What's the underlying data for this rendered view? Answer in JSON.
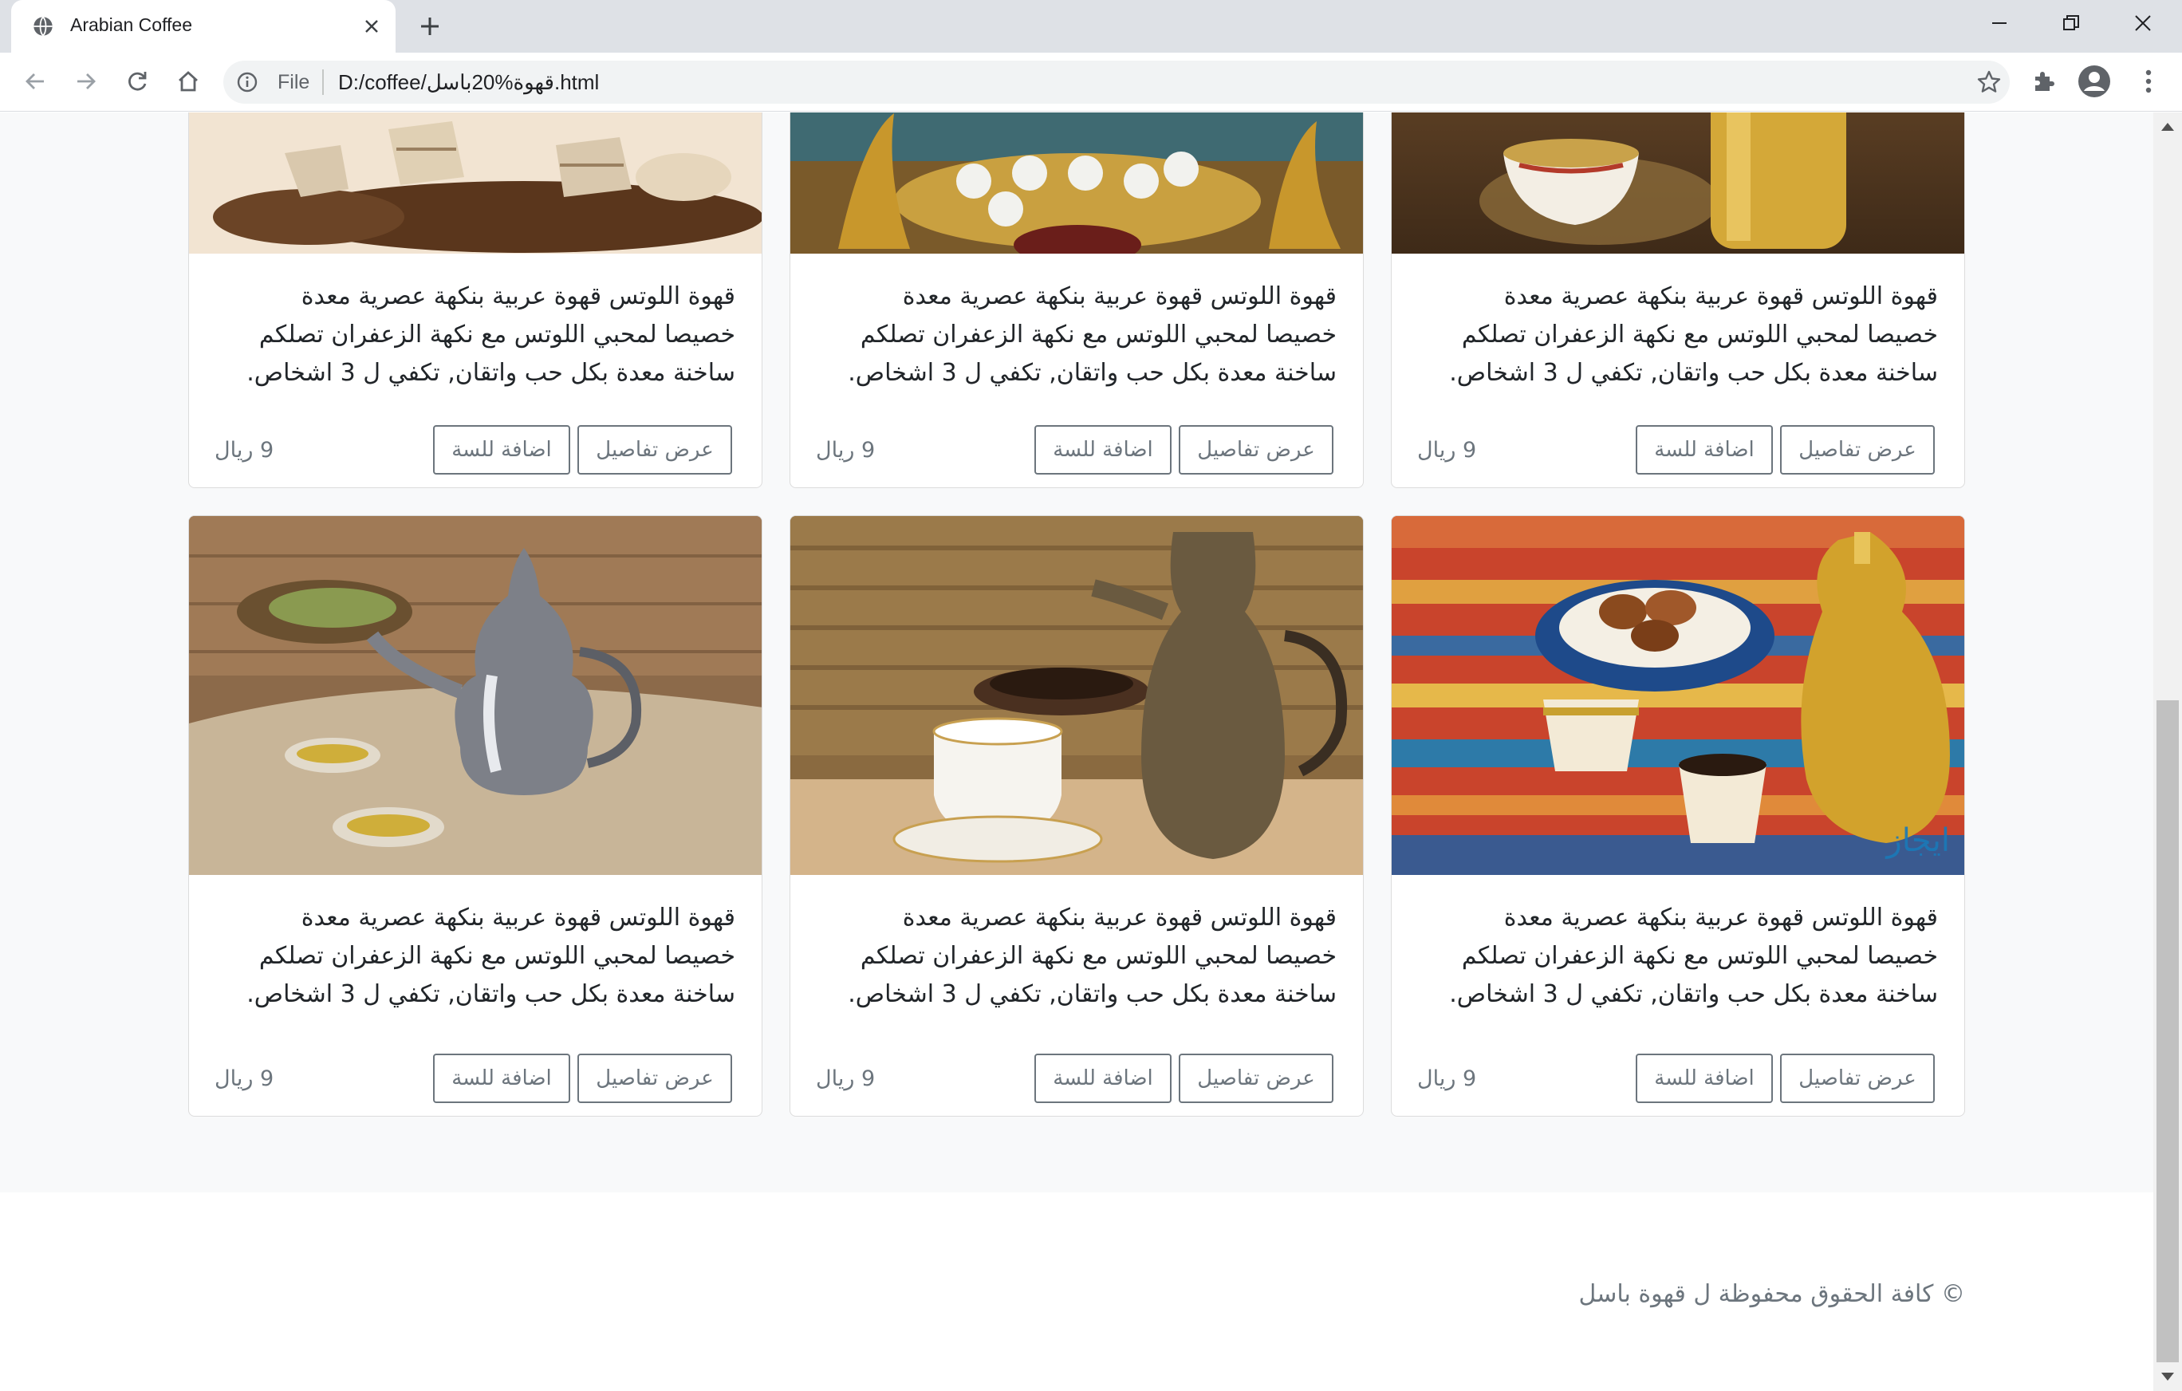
{
  "browser": {
    "tab_title": "Arabian Coffee",
    "url_scheme": "File",
    "url": "D:/coffee/قهوة%20باسل.html"
  },
  "products": [
    {
      "description": "قهوة اللوتس قهوة عربية بنكهة عصرية معدة خصيصا لمحبي اللوتس مع نكهة الزعفران تصلكم ساخنة معدة بكل حب واتقان, تكفي ل 3 اشخاص.",
      "details_label": "عرض تفاصيل",
      "add_label": "اضافة للسة",
      "price": "9 ريال"
    },
    {
      "description": "قهوة اللوتس قهوة عربية بنكهة عصرية معدة خصيصا لمحبي اللوتس مع نكهة الزعفران تصلكم ساخنة معدة بكل حب واتقان, تكفي ل 3 اشخاص.",
      "details_label": "عرض تفاصيل",
      "add_label": "اضافة للسة",
      "price": "9 ريال"
    },
    {
      "description": "قهوة اللوتس قهوة عربية بنكهة عصرية معدة خصيصا لمحبي اللوتس مع نكهة الزعفران تصلكم ساخنة معدة بكل حب واتقان, تكفي ل 3 اشخاص.",
      "details_label": "عرض تفاصيل",
      "add_label": "اضافة للسة",
      "price": "9 ريال"
    },
    {
      "description": "قهوة اللوتس قهوة عربية بنكهة عصرية معدة خصيصا لمحبي اللوتس مع نكهة الزعفران تصلكم ساخنة معدة بكل حب واتقان, تكفي ل 3 اشخاص.",
      "details_label": "عرض تفاصيل",
      "add_label": "اضافة للسة",
      "price": "9 ريال"
    },
    {
      "description": "قهوة اللوتس قهوة عربية بنكهة عصرية معدة خصيصا لمحبي اللوتس مع نكهة الزعفران تصلكم ساخنة معدة بكل حب واتقان, تكفي ل 3 اشخاص.",
      "details_label": "عرض تفاصيل",
      "add_label": "اضافة للسة",
      "price": "9 ريال"
    },
    {
      "description": "قهوة اللوتس قهوة عربية بنكهة عصرية معدة خصيصا لمحبي اللوتس مع نكهة الزعفران تصلكم ساخنة معدة بكل حب واتقان, تكفي ل 3 اشخاص.",
      "details_label": "عرض تفاصيل",
      "add_label": "اضافة للسة",
      "price": "9 ريال",
      "image_watermark": "ايجاز"
    }
  ],
  "footer": {
    "copyright": "© كافة الحقوق محفوظة ل قهوة باسل"
  },
  "colors": {
    "tabstrip": "#dee1e6",
    "page_bg": "#f8f9fa",
    "button_outline": "#6c757d"
  },
  "icons": [
    "globe-icon",
    "close-icon",
    "plus-icon",
    "minimize-icon",
    "restore-icon",
    "back-icon",
    "forward-icon",
    "reload-icon",
    "home-icon",
    "info-icon",
    "star-icon",
    "extensions-icon",
    "profile-icon",
    "menu-icon"
  ]
}
